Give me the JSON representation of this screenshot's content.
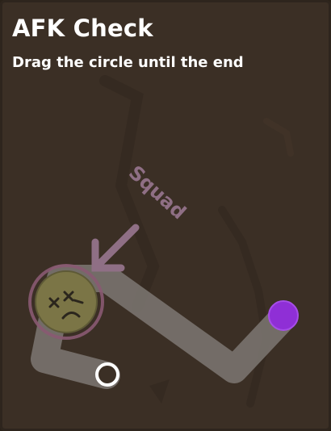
{
  "title": "AFK Check",
  "instruction": "Drag the circle until the end",
  "watermark": {
    "text": "Squad",
    "color": "#8f6f85"
  },
  "colors": {
    "panel_bg": "#3b2f25",
    "path": "#76706a",
    "target_dot": "#8f2fd6",
    "puck_fill": "#7b7546",
    "puck_ring": "#8a5a72"
  },
  "icons": {
    "puck": "dead-face-icon",
    "arrow": "arrow-down-left-icon",
    "start": "start-ring-icon",
    "end": "goal-dot-icon"
  }
}
